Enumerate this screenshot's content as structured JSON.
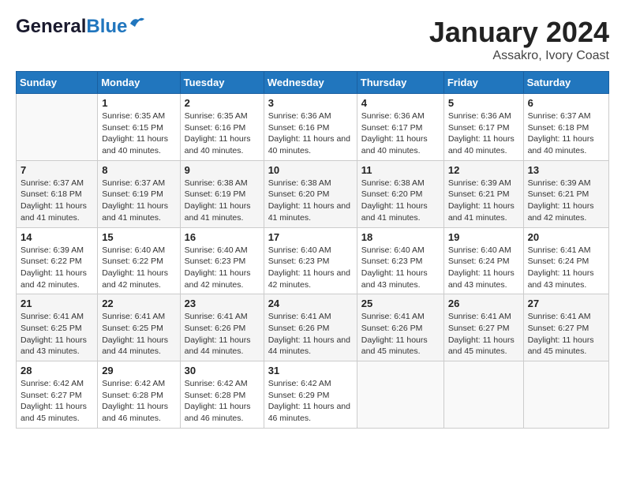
{
  "header": {
    "logo_general": "General",
    "logo_blue": "Blue",
    "month_title": "January 2024",
    "subtitle": "Assakro, Ivory Coast"
  },
  "weekdays": [
    "Sunday",
    "Monday",
    "Tuesday",
    "Wednesday",
    "Thursday",
    "Friday",
    "Saturday"
  ],
  "weeks": [
    [
      {
        "day": "",
        "sunrise": "",
        "sunset": "",
        "daylight": ""
      },
      {
        "day": "1",
        "sunrise": "Sunrise: 6:35 AM",
        "sunset": "Sunset: 6:15 PM",
        "daylight": "Daylight: 11 hours and 40 minutes."
      },
      {
        "day": "2",
        "sunrise": "Sunrise: 6:35 AM",
        "sunset": "Sunset: 6:16 PM",
        "daylight": "Daylight: 11 hours and 40 minutes."
      },
      {
        "day": "3",
        "sunrise": "Sunrise: 6:36 AM",
        "sunset": "Sunset: 6:16 PM",
        "daylight": "Daylight: 11 hours and 40 minutes."
      },
      {
        "day": "4",
        "sunrise": "Sunrise: 6:36 AM",
        "sunset": "Sunset: 6:17 PM",
        "daylight": "Daylight: 11 hours and 40 minutes."
      },
      {
        "day": "5",
        "sunrise": "Sunrise: 6:36 AM",
        "sunset": "Sunset: 6:17 PM",
        "daylight": "Daylight: 11 hours and 40 minutes."
      },
      {
        "day": "6",
        "sunrise": "Sunrise: 6:37 AM",
        "sunset": "Sunset: 6:18 PM",
        "daylight": "Daylight: 11 hours and 40 minutes."
      }
    ],
    [
      {
        "day": "7",
        "sunrise": "Sunrise: 6:37 AM",
        "sunset": "Sunset: 6:18 PM",
        "daylight": "Daylight: 11 hours and 41 minutes."
      },
      {
        "day": "8",
        "sunrise": "Sunrise: 6:37 AM",
        "sunset": "Sunset: 6:19 PM",
        "daylight": "Daylight: 11 hours and 41 minutes."
      },
      {
        "day": "9",
        "sunrise": "Sunrise: 6:38 AM",
        "sunset": "Sunset: 6:19 PM",
        "daylight": "Daylight: 11 hours and 41 minutes."
      },
      {
        "day": "10",
        "sunrise": "Sunrise: 6:38 AM",
        "sunset": "Sunset: 6:20 PM",
        "daylight": "Daylight: 11 hours and 41 minutes."
      },
      {
        "day": "11",
        "sunrise": "Sunrise: 6:38 AM",
        "sunset": "Sunset: 6:20 PM",
        "daylight": "Daylight: 11 hours and 41 minutes."
      },
      {
        "day": "12",
        "sunrise": "Sunrise: 6:39 AM",
        "sunset": "Sunset: 6:21 PM",
        "daylight": "Daylight: 11 hours and 41 minutes."
      },
      {
        "day": "13",
        "sunrise": "Sunrise: 6:39 AM",
        "sunset": "Sunset: 6:21 PM",
        "daylight": "Daylight: 11 hours and 42 minutes."
      }
    ],
    [
      {
        "day": "14",
        "sunrise": "Sunrise: 6:39 AM",
        "sunset": "Sunset: 6:22 PM",
        "daylight": "Daylight: 11 hours and 42 minutes."
      },
      {
        "day": "15",
        "sunrise": "Sunrise: 6:40 AM",
        "sunset": "Sunset: 6:22 PM",
        "daylight": "Daylight: 11 hours and 42 minutes."
      },
      {
        "day": "16",
        "sunrise": "Sunrise: 6:40 AM",
        "sunset": "Sunset: 6:23 PM",
        "daylight": "Daylight: 11 hours and 42 minutes."
      },
      {
        "day": "17",
        "sunrise": "Sunrise: 6:40 AM",
        "sunset": "Sunset: 6:23 PM",
        "daylight": "Daylight: 11 hours and 42 minutes."
      },
      {
        "day": "18",
        "sunrise": "Sunrise: 6:40 AM",
        "sunset": "Sunset: 6:23 PM",
        "daylight": "Daylight: 11 hours and 43 minutes."
      },
      {
        "day": "19",
        "sunrise": "Sunrise: 6:40 AM",
        "sunset": "Sunset: 6:24 PM",
        "daylight": "Daylight: 11 hours and 43 minutes."
      },
      {
        "day": "20",
        "sunrise": "Sunrise: 6:41 AM",
        "sunset": "Sunset: 6:24 PM",
        "daylight": "Daylight: 11 hours and 43 minutes."
      }
    ],
    [
      {
        "day": "21",
        "sunrise": "Sunrise: 6:41 AM",
        "sunset": "Sunset: 6:25 PM",
        "daylight": "Daylight: 11 hours and 43 minutes."
      },
      {
        "day": "22",
        "sunrise": "Sunrise: 6:41 AM",
        "sunset": "Sunset: 6:25 PM",
        "daylight": "Daylight: 11 hours and 44 minutes."
      },
      {
        "day": "23",
        "sunrise": "Sunrise: 6:41 AM",
        "sunset": "Sunset: 6:26 PM",
        "daylight": "Daylight: 11 hours and 44 minutes."
      },
      {
        "day": "24",
        "sunrise": "Sunrise: 6:41 AM",
        "sunset": "Sunset: 6:26 PM",
        "daylight": "Daylight: 11 hours and 44 minutes."
      },
      {
        "day": "25",
        "sunrise": "Sunrise: 6:41 AM",
        "sunset": "Sunset: 6:26 PM",
        "daylight": "Daylight: 11 hours and 45 minutes."
      },
      {
        "day": "26",
        "sunrise": "Sunrise: 6:41 AM",
        "sunset": "Sunset: 6:27 PM",
        "daylight": "Daylight: 11 hours and 45 minutes."
      },
      {
        "day": "27",
        "sunrise": "Sunrise: 6:41 AM",
        "sunset": "Sunset: 6:27 PM",
        "daylight": "Daylight: 11 hours and 45 minutes."
      }
    ],
    [
      {
        "day": "28",
        "sunrise": "Sunrise: 6:42 AM",
        "sunset": "Sunset: 6:27 PM",
        "daylight": "Daylight: 11 hours and 45 minutes."
      },
      {
        "day": "29",
        "sunrise": "Sunrise: 6:42 AM",
        "sunset": "Sunset: 6:28 PM",
        "daylight": "Daylight: 11 hours and 46 minutes."
      },
      {
        "day": "30",
        "sunrise": "Sunrise: 6:42 AM",
        "sunset": "Sunset: 6:28 PM",
        "daylight": "Daylight: 11 hours and 46 minutes."
      },
      {
        "day": "31",
        "sunrise": "Sunrise: 6:42 AM",
        "sunset": "Sunset: 6:29 PM",
        "daylight": "Daylight: 11 hours and 46 minutes."
      },
      {
        "day": "",
        "sunrise": "",
        "sunset": "",
        "daylight": ""
      },
      {
        "day": "",
        "sunrise": "",
        "sunset": "",
        "daylight": ""
      },
      {
        "day": "",
        "sunrise": "",
        "sunset": "",
        "daylight": ""
      }
    ]
  ]
}
